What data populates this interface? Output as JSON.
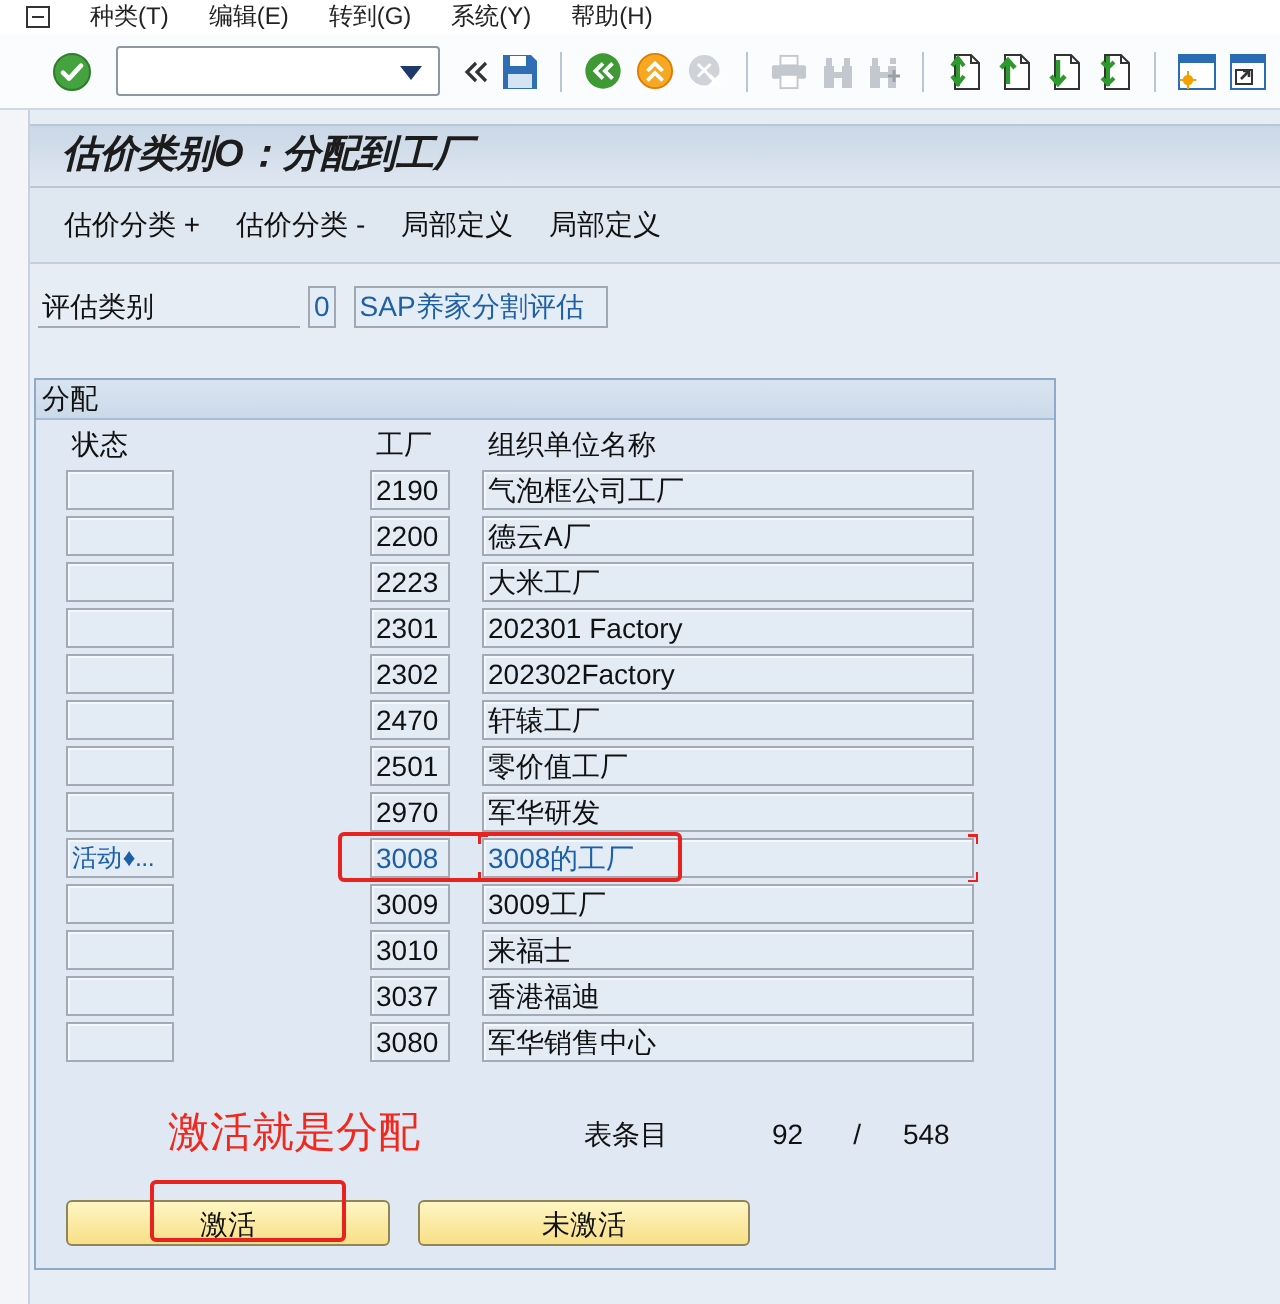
{
  "menu_bar": {
    "items": [
      "种类(T)",
      "编辑(E)",
      "转到(G)",
      "系统(Y)",
      "帮助(H)"
    ]
  },
  "toolbar": {
    "groups": [
      [
        {
          "kind": "enter",
          "disabled": false
        }
      ],
      [
        {
          "kind": "collapse",
          "disabled": false
        },
        {
          "kind": "save",
          "disabled": false
        }
      ],
      [
        {
          "kind": "back",
          "disabled": false
        },
        {
          "kind": "exit",
          "disabled": false
        },
        {
          "kind": "cancel",
          "disabled": true
        }
      ],
      [
        {
          "kind": "print",
          "disabled": true
        },
        {
          "kind": "find",
          "disabled": true
        },
        {
          "kind": "find_next",
          "disabled": true
        }
      ],
      [
        {
          "kind": "first_page",
          "disabled": false
        },
        {
          "kind": "previous_page",
          "disabled": false
        },
        {
          "kind": "next_page",
          "disabled": false
        },
        {
          "kind": "last_page",
          "disabled": false
        }
      ],
      [
        {
          "kind": "new_session",
          "disabled": false
        },
        {
          "kind": "shortcut",
          "disabled": false
        }
      ]
    ]
  },
  "title": "估价类别O：分配到工厂",
  "application_toolbar": [
    "估价分类 +",
    "估价分类 -",
    "局部定义",
    "局部定义"
  ],
  "valuation_category": {
    "label": "评估类别",
    "value": "0",
    "description": "SAP养家分割评估"
  },
  "assignment": {
    "title": "分配",
    "columns": [
      "状态",
      "工厂",
      "组织单位名称"
    ],
    "rows": [
      {
        "plant": "2190",
        "name": "气泡框公司工厂",
        "active": false,
        "focused": false,
        "highlighted": false
      },
      {
        "plant": "2200",
        "name": "德云A厂",
        "active": false,
        "focused": false,
        "highlighted": false
      },
      {
        "plant": "2223",
        "name": "大米工厂",
        "active": false,
        "focused": false,
        "highlighted": false
      },
      {
        "plant": "2301",
        "name": "202301 Factory",
        "active": false,
        "focused": false,
        "highlighted": false
      },
      {
        "plant": "2302",
        "name": "202302Factory",
        "active": false,
        "focused": false,
        "highlighted": false
      },
      {
        "plant": "2470",
        "name": "轩辕工厂",
        "active": false,
        "focused": false,
        "highlighted": false
      },
      {
        "plant": "2501",
        "name": "零价值工厂",
        "active": false,
        "focused": false,
        "highlighted": false
      },
      {
        "plant": "2970",
        "name": "军华研发",
        "active": false,
        "focused": false,
        "highlighted": false
      },
      {
        "status": "活动♦...",
        "plant": "3008",
        "name": "3008的工厂",
        "active": true,
        "focused": true,
        "highlighted": true
      },
      {
        "plant": "3009",
        "name": "3009工厂",
        "active": false,
        "focused": false,
        "highlighted": false
      },
      {
        "plant": "3010",
        "name": "来福士",
        "active": false,
        "focused": false,
        "highlighted": false
      },
      {
        "plant": "3037",
        "name": "香港福迪",
        "active": false,
        "focused": false,
        "highlighted": false
      },
      {
        "plant": "3080",
        "name": "军华销售中心",
        "active": false,
        "focused": false,
        "highlighted": false
      }
    ],
    "annotation": "激活就是分配",
    "entries": {
      "label": "表条目",
      "current": "92",
      "separator": "/",
      "total": "548"
    },
    "buttons": [
      {
        "label": "激活",
        "highlighted": true
      },
      {
        "label": "未激活",
        "highlighted": false
      }
    ]
  }
}
